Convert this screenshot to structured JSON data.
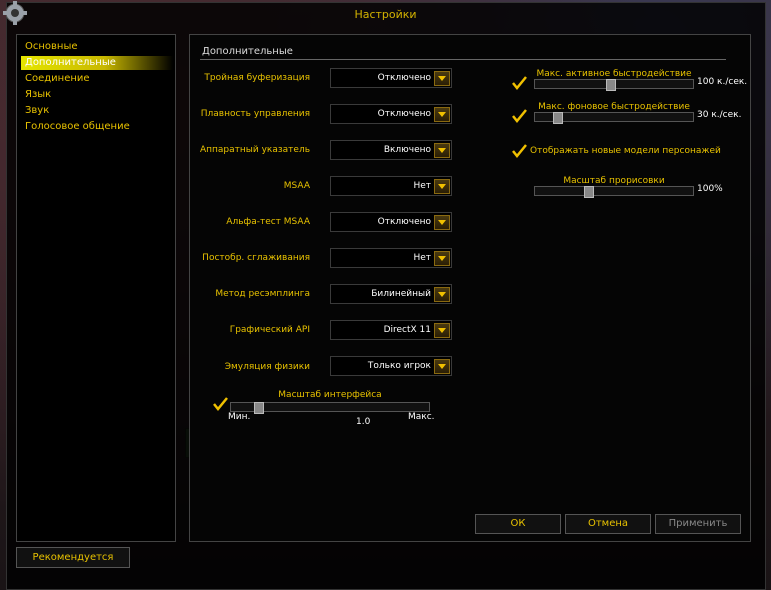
{
  "window": {
    "title": "Настройки"
  },
  "sidebar": {
    "items": [
      {
        "label": "Основные"
      },
      {
        "label": "Дополнительные"
      },
      {
        "label": "Соединение"
      },
      {
        "label": "Язык"
      },
      {
        "label": "Звук"
      },
      {
        "label": "Голосовое общение"
      }
    ],
    "active_index": 1,
    "recommend_label": "Рекомендуется"
  },
  "panel": {
    "title": "Дополнительные",
    "settings": [
      {
        "label": "Тройная буферизация",
        "value": "Отключено"
      },
      {
        "label": "Плавность управления",
        "value": "Отключено"
      },
      {
        "label": "Аппаратный указатель",
        "value": "Включено"
      },
      {
        "label": "MSAA",
        "value": "Нет"
      },
      {
        "label": "Альфа-тест MSAA",
        "value": "Отключено"
      },
      {
        "label": "Постобр. сглаживания",
        "value": "Нет"
      },
      {
        "label": "Метод ресэмплинга",
        "value": "Билинейный"
      },
      {
        "label": "Графический API",
        "value": "DirectX 11"
      },
      {
        "label": "Эмуляция физики",
        "value": "Только игрок"
      }
    ],
    "ui_scale": {
      "label": "Масштаб интерфейса",
      "min_label": "Мин.",
      "max_label": "Макс.",
      "value": "1.0",
      "fraction": 0.12,
      "checked": true
    },
    "right": {
      "max_fg_fps": {
        "label": "Макс. активное быстродействие",
        "value": "100 к./сек.",
        "fraction": 0.48,
        "checked": true
      },
      "max_bg_fps": {
        "label": "Макс. фоновое быстродействие",
        "value": "30 к./сек.",
        "fraction": 0.12,
        "checked": true
      },
      "new_models": {
        "label": "Отображать новые модели персонажей",
        "checked": true
      },
      "render_scale": {
        "label": "Масштаб прорисовки",
        "value": "100%",
        "fraction": 0.33
      }
    }
  },
  "footer": {
    "ok": "ОК",
    "cancel": "Отмена",
    "apply": "Применить"
  },
  "colors": {
    "accent": "#e8c200",
    "highlight": "#e6e600"
  }
}
